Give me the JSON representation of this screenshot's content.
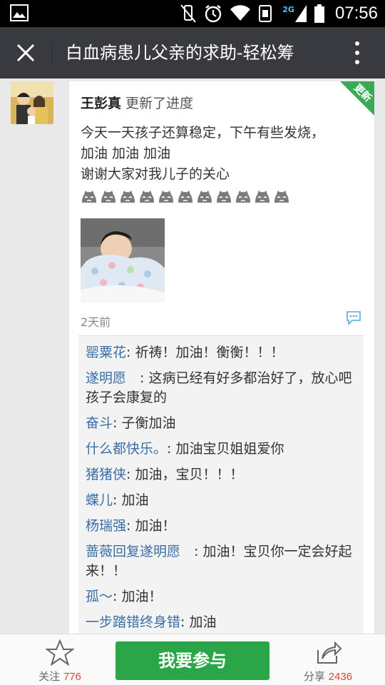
{
  "status_bar": {
    "network_label": "2G",
    "time": "07:56"
  },
  "title_bar": {
    "title": "白血病患儿父亲的求助-轻松筹"
  },
  "post": {
    "badge": "更新",
    "author": "王彭真",
    "action": "更新了进度",
    "lines": [
      "今天一天孩子还算稳定，下午有些发烧，",
      "加油 加油 加油",
      "谢谢大家对我儿子的关心"
    ],
    "emoji_count": 11,
    "emoji_icon": "sad-face-icon",
    "time_ago": "2天前"
  },
  "comments": [
    {
      "name": "罂粟花",
      "sep": ": ",
      "text": "祈祷！加油！衡衡！！！"
    },
    {
      "name": "遂明愿",
      "sep": "　: ",
      "text": "这病已经有好多都治好了，放心吧孩子会康复的"
    },
    {
      "name": "奋斗",
      "sep": ": ",
      "text": "子衡加油"
    },
    {
      "name": "什么都快乐。",
      "sep": ": ",
      "text": "加油宝贝姐姐爱你"
    },
    {
      "name": "猪猪侠",
      "sep": ": ",
      "text": "加油，宝贝！！！"
    },
    {
      "name": "蝶儿",
      "sep": ": ",
      "text": "加油"
    },
    {
      "name": "杨瑞强",
      "sep": ": ",
      "text": "加油！"
    },
    {
      "name": "蔷薇回复遂明愿",
      "sep": "　: ",
      "text": "加油！宝贝你一定会好起来！！"
    },
    {
      "name": "孤～",
      "sep": ": ",
      "text": "加油！"
    },
    {
      "name": "一步踏错终身错",
      "sep": ": ",
      "text": "加油"
    }
  ],
  "bottom_bar": {
    "follow_label": "关注",
    "follow_count": "776",
    "join_label": "我要参与",
    "share_label": "分享",
    "share_count": "2436"
  },
  "colors": {
    "title_bar": "#393a3f",
    "accent_green": "#2aa649",
    "name_blue": "#3a6ea5",
    "count_red": "#d9463a"
  }
}
